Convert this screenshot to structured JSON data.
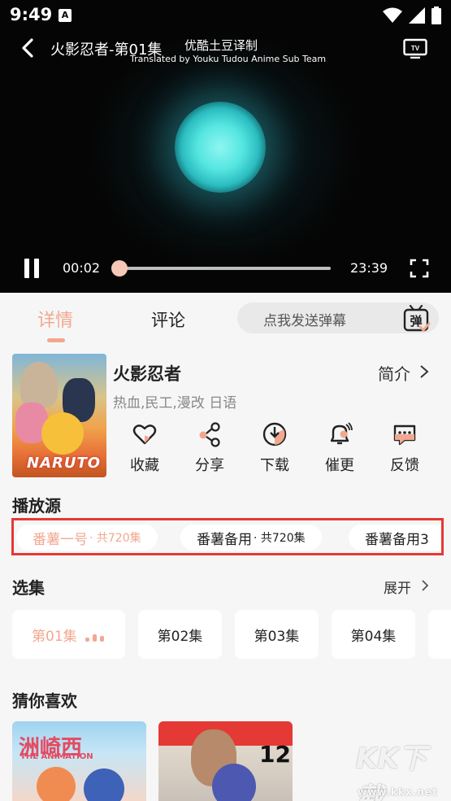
{
  "status_bar": {
    "time": "9:49"
  },
  "player": {
    "title": "火影忍者-第01集",
    "subtitle_cn": "优酷土豆译制",
    "subtitle_en": "Translated by Youku Tudou Anime Sub Team",
    "current_time": "00:02",
    "duration": "23:39",
    "progress": 0.0014
  },
  "tabs": {
    "detail": "详情",
    "comment": "评论"
  },
  "danmaku": {
    "placeholder": "点我发送弹幕",
    "icon_text": "弹"
  },
  "show": {
    "name": "火影忍者",
    "intro_label": "简介",
    "tags": "热血,民工,漫改 日语",
    "poster_logo": "NARUTO"
  },
  "actions": [
    {
      "label": "收藏",
      "icon": "heart-icon"
    },
    {
      "label": "分享",
      "icon": "share-icon"
    },
    {
      "label": "下载",
      "icon": "download-icon"
    },
    {
      "label": "催更",
      "icon": "bell-icon"
    },
    {
      "label": "反馈",
      "icon": "feedback-icon"
    }
  ],
  "sources": {
    "heading": "播放源",
    "items": [
      {
        "name": "番薯一号",
        "count": " · 共720集",
        "active": true
      },
      {
        "name": "番薯备用",
        "count": " · 共720集",
        "active": false
      },
      {
        "name": "番薯备用3",
        "count": "",
        "active": false
      }
    ]
  },
  "episodes": {
    "heading": "选集",
    "expand_label": "展开",
    "items": [
      "第01集",
      "第02集",
      "第03集",
      "第04集"
    ]
  },
  "recommend": {
    "heading": "猜你喜欢",
    "items": [
      {
        "title_cn": "洲崎西",
        "title_en": "THE ANIMATION"
      },
      {
        "number": "12"
      }
    ]
  },
  "watermark": {
    "logo": "KK下载",
    "url": "www.kkx.net"
  },
  "colors": {
    "accent": "#f2a890",
    "highlight_box": "#e53935"
  }
}
